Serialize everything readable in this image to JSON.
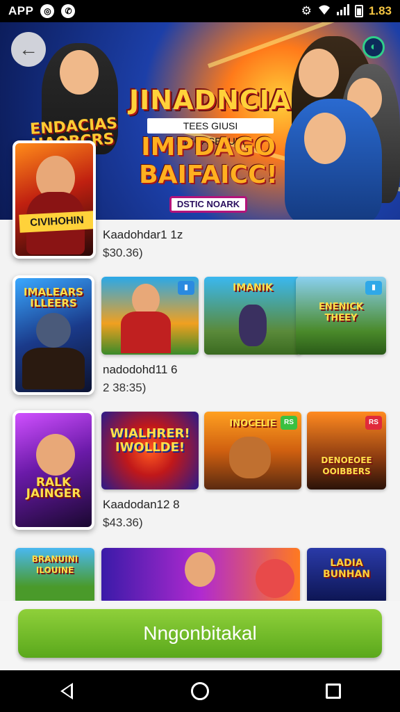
{
  "status_bar": {
    "app_label": "APP",
    "icon_1": "instagram-icon",
    "icon_2": "viber-icon",
    "time": "1.83"
  },
  "hero": {
    "title": "JINADNCIA",
    "subtitle": "TEES GIUSI MIGGASEUUNI",
    "title2": "IMPDAGO BAIFAICC!",
    "pill": "DSTIC NOARK",
    "left_title": "ENDACIAS HAOBCRS"
  },
  "featured": {
    "caption": "CIVIHOHIN",
    "name": "Kaadohdar1 1z",
    "price": "$30.36)"
  },
  "rows": [
    {
      "big_label": "IMALEARS ILLEERS",
      "name": "nadodohd11 6",
      "price": "2 38:35)",
      "cards": [
        {
          "label": "",
          "badge": ""
        },
        {
          "label": "IMANIK",
          "badge": ""
        },
        {
          "label": "ENENICK THEEY",
          "badge": ""
        }
      ]
    },
    {
      "big_label": "RALK JAINGER",
      "name": "Kaadodan12 8",
      "price": "$43.36)",
      "cards": [
        {
          "label": "WIALHRER! IWOLLDE!",
          "badge": ""
        },
        {
          "label": "INOCELIE",
          "badge": "RS"
        },
        {
          "label": "DENOEOEE OOIBBERS",
          "badge": "RS"
        }
      ]
    },
    {
      "big_label": "BRANUINI ILOUINE",
      "cards": [
        {
          "label": "",
          "badge": ""
        },
        {
          "label": "",
          "badge": ""
        },
        {
          "label": "LADIA BUNHAN",
          "badge": ""
        }
      ]
    }
  ],
  "cta": {
    "label": "Nngonbitakal"
  },
  "colors": {
    "cta_green": "#6cbd24",
    "status_time": "#f5c542"
  }
}
